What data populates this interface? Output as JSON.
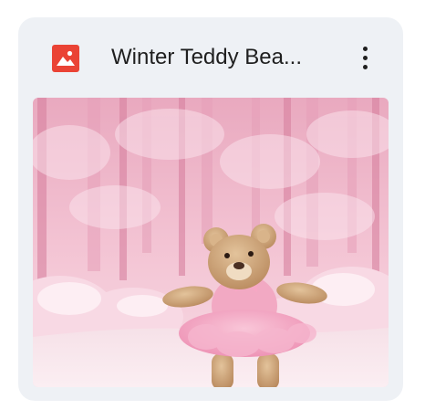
{
  "file_card": {
    "title": "Winter Teddy Bea...",
    "file_type_icon": "image-file-icon",
    "more_icon": "more-vert-icon",
    "thumbnail_icon": "teddy-bear-thumbnail",
    "colors": {
      "card_background": "#eef1f5",
      "icon_red": "#ea4335",
      "title_text": "#1f1f1f",
      "thumbnail_pink": "#f3c6d6"
    }
  }
}
